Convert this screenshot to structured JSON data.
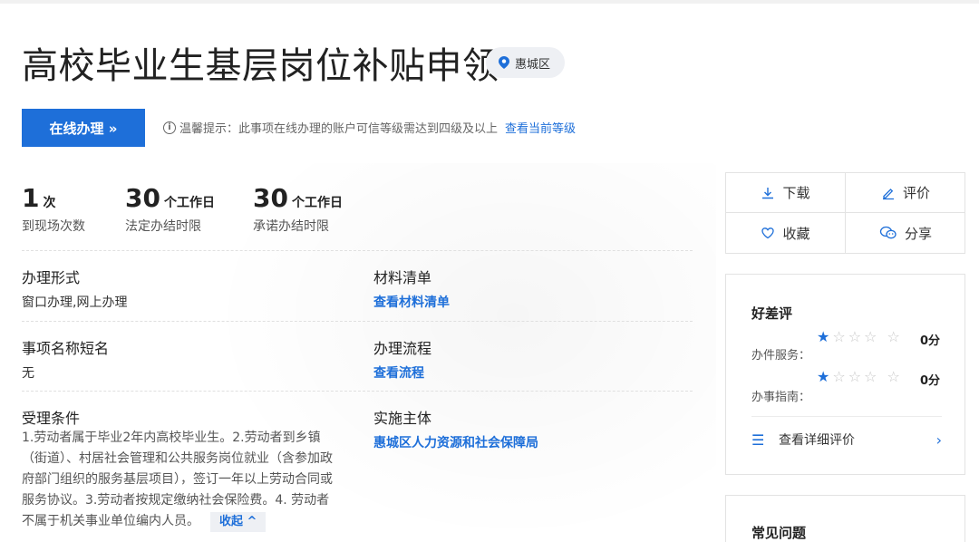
{
  "title": "高校毕业生基层岗位补贴申领",
  "region": "惠城区",
  "online_button": "在线办理 »",
  "tip": {
    "icon": "info-icon",
    "text": "温馨提示：此事项在线办理的账户可信等级需达到四级及以上",
    "link": "查看当前等级"
  },
  "stats": [
    {
      "num": "1",
      "unit": "次",
      "label": "到现场次数"
    },
    {
      "num": "30",
      "unit": "个工作日",
      "label": "法定办结时限"
    },
    {
      "num": "30",
      "unit": "个工作日",
      "label": "承诺办结时限"
    }
  ],
  "fields": {
    "form": {
      "label": "办理形式",
      "value": "窗口办理,网上办理"
    },
    "materials": {
      "label": "材料清单",
      "value": "查看材料清单"
    },
    "short_name": {
      "label": "事项名称短名",
      "value": "无"
    },
    "process": {
      "label": "办理流程",
      "value": "查看流程"
    },
    "conditions": {
      "label": "受理条件",
      "value": "1.劳动者属于毕业2年内高校毕业生。2.劳动者到乡镇（街道）、村居社会管理和公共服务岗位就业（含参加政府部门组织的服务基层项目），签订一年以上劳动合同或服务协议。3.劳动者按规定缴纳社会保险费。4. 劳动者不属于机关事业单位编内人员。",
      "collapse": "收起 ^"
    },
    "subject": {
      "label": "实施主体",
      "value": "惠城区人力资源和社会保障局"
    }
  },
  "actions": {
    "download": "下载",
    "review": "评价",
    "favorite": "收藏",
    "share": "分享"
  },
  "rating": {
    "title": "好差评",
    "rows": [
      {
        "label": "办件服务：",
        "score": "0分",
        "filled_stars": 1,
        "total_stars": 5
      },
      {
        "label": "办事指南：",
        "score": "0分",
        "filled_stars": 1,
        "total_stars": 5
      }
    ],
    "detail_link": "查看详细评价"
  },
  "faq": {
    "title": "常见问题"
  },
  "colors": {
    "accent": "#1e6fd9"
  }
}
